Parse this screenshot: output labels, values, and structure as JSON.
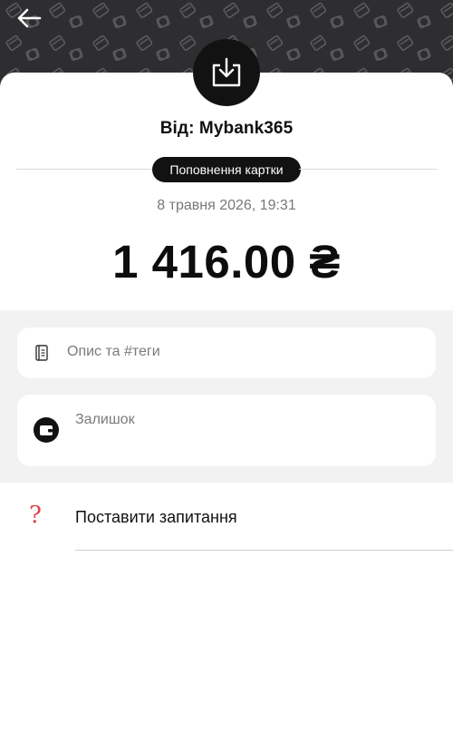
{
  "header": {
    "back_icon": "arrow-left-icon",
    "pattern_colors": {
      "background": "#2e2e30",
      "pattern": "#5a5a5c"
    }
  },
  "transaction": {
    "icon": "incoming-download-icon",
    "from_label": "Від: Mybank365",
    "category": "Поповнення картки",
    "datetime": "8 травня 2026, 19:31",
    "amount": "1 416.00 ₴"
  },
  "details": {
    "description_placeholder": "Опис та #теги",
    "description_icon": "notes-icon",
    "balance_label": "Залишок",
    "balance_icon": "wallet-icon"
  },
  "actions": {
    "ask_question_label": "Поставити запитання",
    "ask_question_icon": "question-mark-icon",
    "accent_color": "#e0424a"
  },
  "colors": {
    "dark": "#121212",
    "section_bg": "#f2f2f2",
    "muted_text": "#777777"
  }
}
